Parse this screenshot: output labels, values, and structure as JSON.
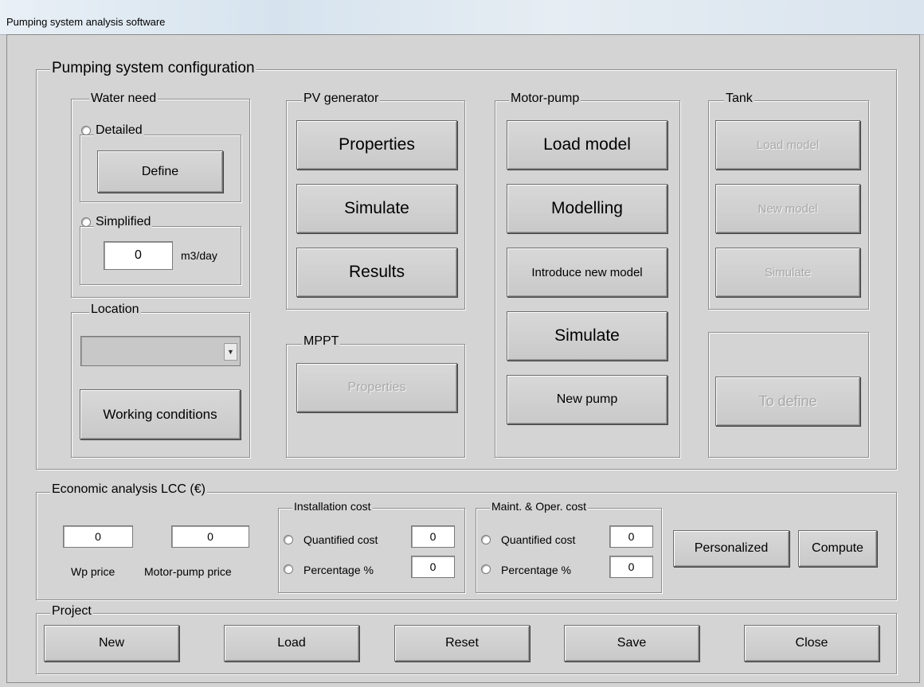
{
  "window": {
    "title": "Pumping system analysis software"
  },
  "config": {
    "title": "Pumping system configuration",
    "water_need": {
      "title": "Water need",
      "detailed": {
        "label": "Detailed",
        "define_button": "Define"
      },
      "simplified": {
        "label": "Simplified",
        "value": "0",
        "unit": "m3/day"
      }
    },
    "location": {
      "title": "Location",
      "dropdown_value": "",
      "working_conditions_button": "Working conditions"
    },
    "pv_generator": {
      "title": "PV generator",
      "properties": "Properties",
      "simulate": "Simulate",
      "results": "Results"
    },
    "mppt": {
      "title": "MPPT",
      "properties": "Properties"
    },
    "motor_pump": {
      "title": "Motor-pump",
      "load_model": "Load model",
      "modelling": "Modelling",
      "introduce_new_model": "Introduce new model",
      "simulate": "Simulate",
      "new_pump": "New pump"
    },
    "tank": {
      "title": "Tank",
      "load_model": "Load model",
      "new_model": "New model",
      "simulate": "Simulate",
      "to_define": "To define"
    }
  },
  "economic": {
    "title": "Economic analysis LCC (€)",
    "wp_price": {
      "value": "0",
      "label": "Wp price"
    },
    "motor_pump_price": {
      "value": "0",
      "label": "Motor-pump price"
    },
    "installation_cost": {
      "title": "Installation cost",
      "quantified_label": "Quantified cost",
      "quantified_value": "0",
      "percentage_label": "Percentage %",
      "percentage_value": "0"
    },
    "maint_cost": {
      "title": "Maint. & Oper. cost",
      "quantified_label": "Quantified cost",
      "quantified_value": "0",
      "percentage_label": "Percentage %",
      "percentage_value": "0"
    },
    "personalized": "Personalized",
    "compute": "Compute"
  },
  "project": {
    "title": "Project",
    "new": "New",
    "load": "Load",
    "reset": "Reset",
    "save": "Save",
    "close": "Close"
  }
}
